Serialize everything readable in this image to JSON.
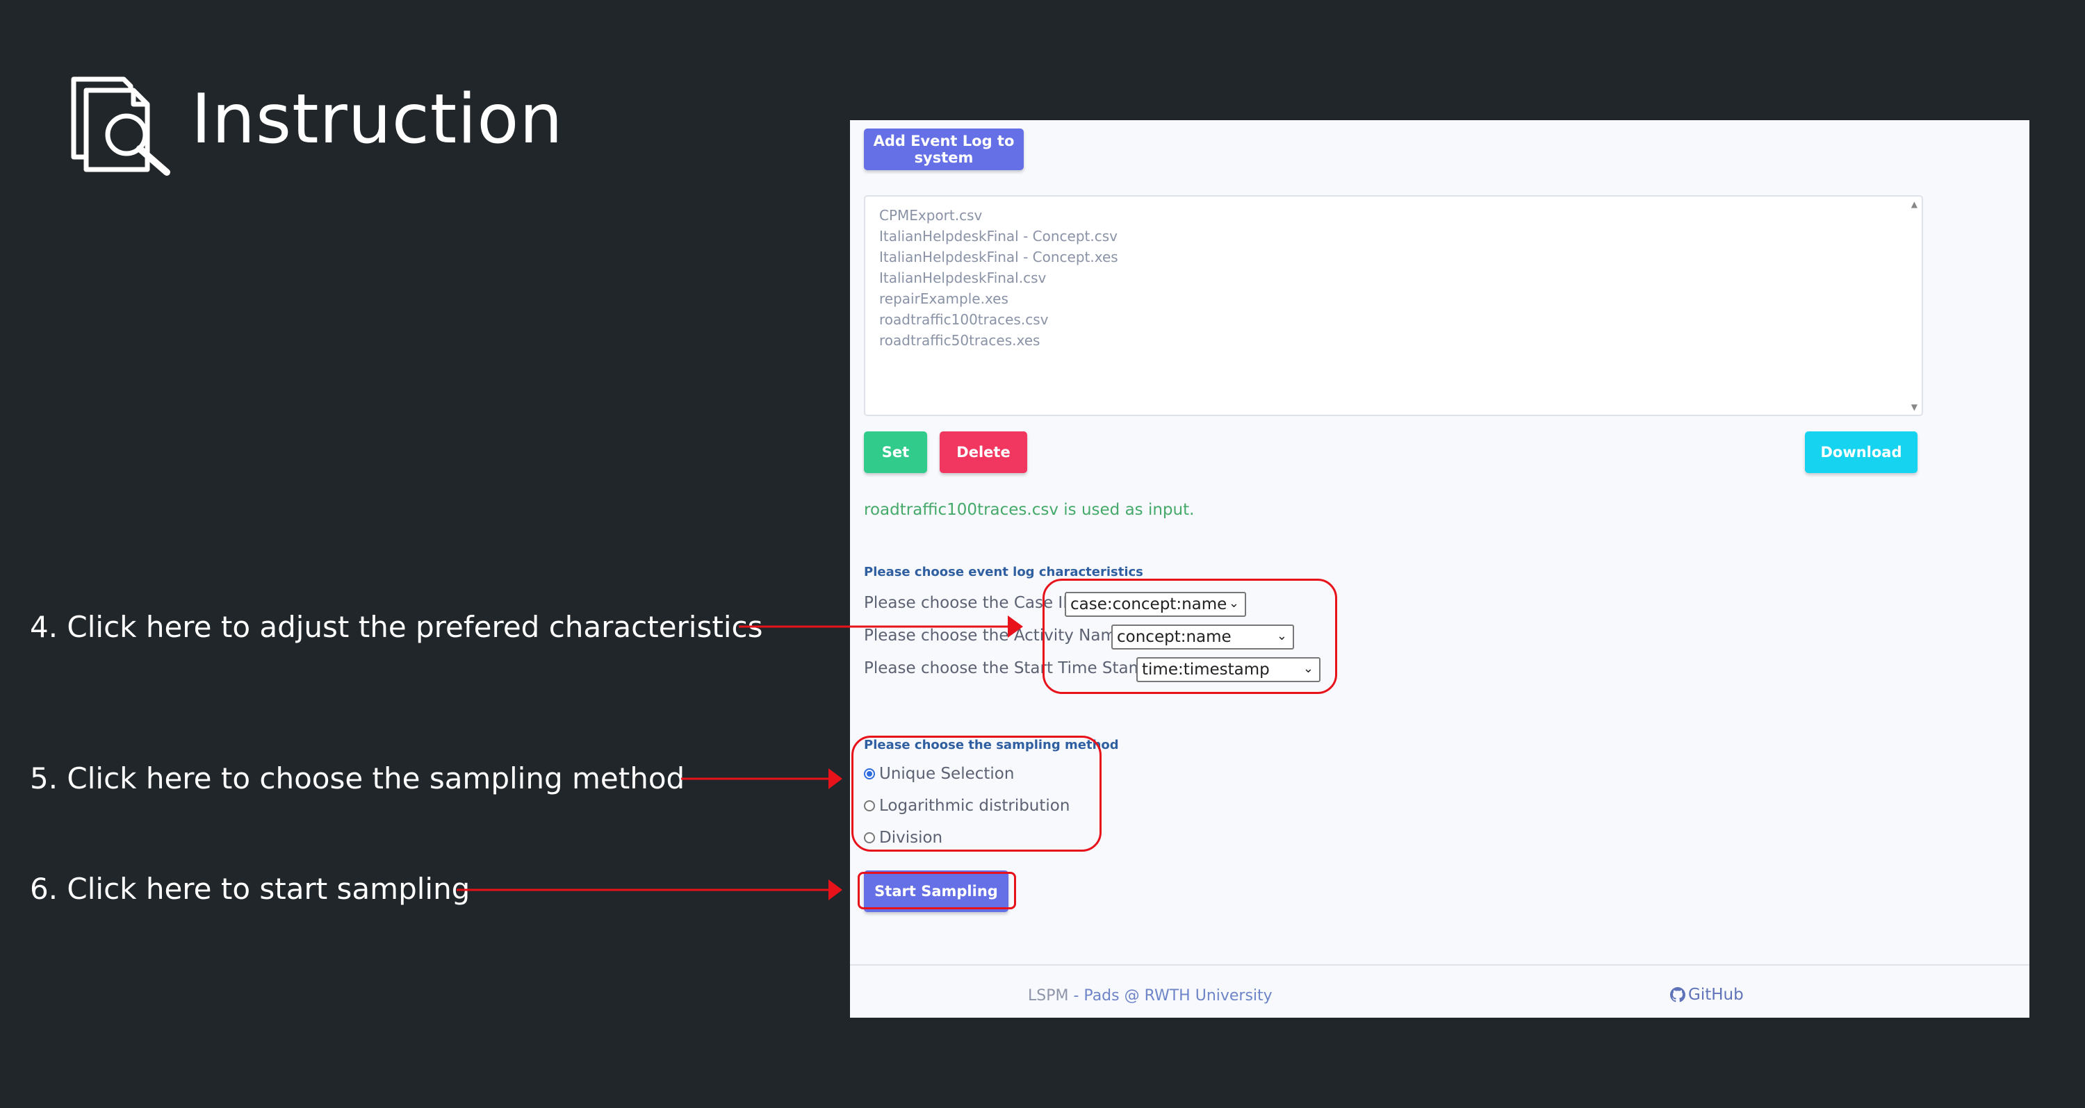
{
  "slide": {
    "title": "Instruction",
    "notes": [
      "4. Click here to adjust the prefered characteristics",
      "5. Click here to choose the sampling method",
      "6. Click here to start sampling"
    ]
  },
  "app": {
    "add_button": "Add Event Log to system",
    "files": [
      "CPMExport.csv",
      "ItalianHelpdeskFinal - Concept.csv",
      "ItalianHelpdeskFinal - Concept.xes",
      "ItalianHelpdeskFinal.csv",
      "repairExample.xes",
      "roadtraffic100traces.csv",
      "roadtraffic50traces.xes"
    ],
    "set_button": "Set",
    "delete_button": "Delete",
    "download_button": "Download",
    "status": "roadtraffic100traces.csv is used as input.",
    "characteristics": {
      "heading": "Please choose event log characteristics",
      "case_label": "Please choose the Case ID:",
      "case_value": "case:concept:name",
      "activity_label": "Please choose the Activity Name:",
      "activity_value": "concept:name",
      "timestamp_label": "Please choose the Start Time Stamp:",
      "timestamp_value": "time:timestamp"
    },
    "sampling": {
      "heading": "Please choose the sampling method",
      "options": [
        "Unique Selection",
        "Logarithmic distribution",
        "Division"
      ],
      "selected": "Unique Selection"
    },
    "start_button": "Start Sampling",
    "footer": {
      "brand": "LSPM",
      "separator": " - ",
      "link": "Pads @ RWTH University",
      "github": "GitHub"
    }
  },
  "colors": {
    "background": "#20262a",
    "primary": "#6670e6",
    "green": "#31cb8b",
    "red": "#f1365f",
    "cyan": "#16d3ef",
    "annotation": "#e8121a"
  }
}
